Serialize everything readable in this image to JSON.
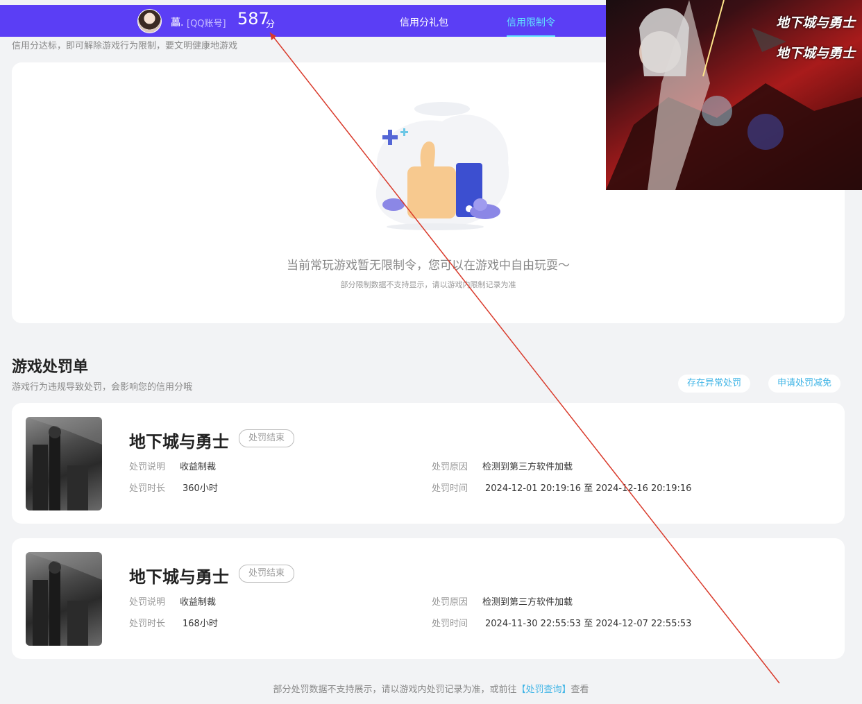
{
  "topbar": {
    "username": "藟.",
    "account": "[QQ账号]",
    "score": "587",
    "score_unit": "分",
    "tabs": [
      {
        "label": "信用分礼包",
        "active": false
      },
      {
        "label": "信用限制令",
        "active": true
      }
    ]
  },
  "subtitle": "信用分达标，即可解除游戏行为限制，要文明健康地游戏",
  "empty_state": {
    "title": "当前常玩游戏暂无限制令，您可以在游戏中自由玩耍～",
    "note": "部分限制数据不支持显示，请以游戏内限制记录为准"
  },
  "ad": {
    "logo_lines": [
      "地下城与勇士",
      "地下城与勇士"
    ]
  },
  "penalty_section": {
    "title": "游戏处罚单",
    "desc": "游戏行为违规导致处罚，会影响您的信用分哦",
    "buttons": [
      "存在异常处罚",
      "申请处罚减免"
    ]
  },
  "penalties": [
    {
      "game": "地下城与勇士",
      "status": "处罚结束",
      "explain_label": "处罚说明",
      "explain": "收益制裁",
      "duration_label": "处罚时长",
      "duration": "360小时",
      "reason_label": "处罚原因",
      "reason": "检测到第三方软件加载",
      "time_label": "处罚时间",
      "time": "2024-12-01 20:19:16 至 2024-12-16 20:19:16"
    },
    {
      "game": "地下城与勇士",
      "status": "处罚结束",
      "explain_label": "处罚说明",
      "explain": "收益制裁",
      "duration_label": "处罚时长",
      "duration": "168小时",
      "reason_label": "处罚原因",
      "reason": "检测到第三方软件加载",
      "time_label": "处罚时间",
      "time": "2024-11-30 22:55:53 至 2024-12-07 22:55:53"
    }
  ],
  "footer": {
    "text": "部分处罚数据不支持展示，请以游戏内处罚记录为准，或前往",
    "link": "【处罚查询】",
    "tail": "查看"
  },
  "colors": {
    "topbar": "#5b3ef5",
    "active_tab": "#61e3ff",
    "link": "#3fb4e6",
    "annotation_arrow": "#d93a2b"
  }
}
